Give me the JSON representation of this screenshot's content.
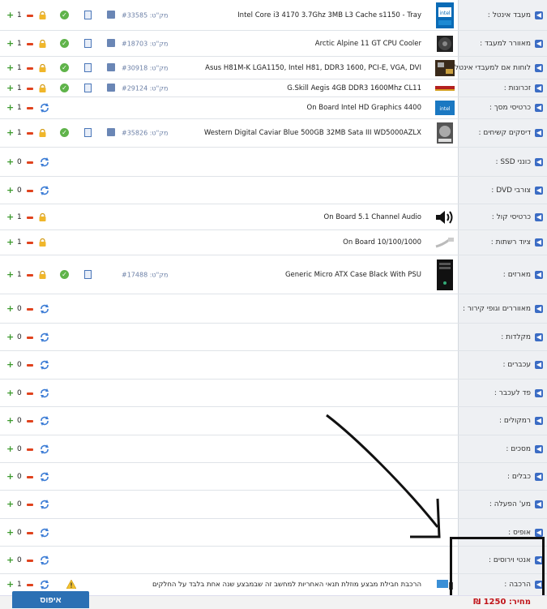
{
  "sku_prefix": "מק\"ט:",
  "rows": [
    {
      "category": "מעבד אינטל :",
      "product": "Intel Core i3 4170 3.7Ghz 3MB L3 Cache s1150 - Tray",
      "sku": "#33585",
      "qty": "1",
      "icon": "cpu-icon",
      "type": "full"
    },
    {
      "category": "מאוורר למעבד :",
      "product": "Arctic Alpine 11 GT CPU Cooler",
      "sku": "#18703",
      "qty": "1",
      "icon": "fan-icon",
      "type": "full"
    },
    {
      "category": "לוחות אם למעבדי אינטל :",
      "product": "Asus H81M-K LGA1150, Intel H81, DDR3 1600, PCI-E, VGA, DVI",
      "sku": "#30918",
      "qty": "1",
      "icon": "motherboard-icon",
      "type": "full"
    },
    {
      "category": "זכרונות :",
      "product": "G.Skill Aegis 4GB DDR3 1600Mhz CL11",
      "sku": "#29124",
      "qty": "1",
      "icon": "ram-icon",
      "type": "full"
    },
    {
      "category": "כרטיסי מסך :",
      "product": "On Board Intel HD Graphics 4400",
      "sku": "",
      "qty": "1",
      "icon": "graphics-icon",
      "type": "onboard"
    },
    {
      "category": "דיסקים קשיחים :",
      "product": "Western Digital Caviar Blue 500GB 32MB Sata III WD5000AZLX",
      "sku": "#35826",
      "qty": "1",
      "icon": "hdd-icon",
      "type": "full"
    },
    {
      "category": "כונני SSD :",
      "product": "",
      "sku": "",
      "qty": "0",
      "icon": "",
      "type": "empty"
    },
    {
      "category": "צורבי DVD :",
      "product": "",
      "sku": "",
      "qty": "0",
      "icon": "",
      "type": "empty"
    },
    {
      "category": "כרטיסי קול :",
      "product": "On Board 5.1 Channel Audio",
      "sku": "",
      "qty": "1",
      "icon": "speaker-icon",
      "type": "lockonly"
    },
    {
      "category": "ציוד רשתות :",
      "product": "On Board 10/100/1000",
      "sku": "",
      "qty": "1",
      "icon": "network-cable-icon",
      "type": "lockonly"
    },
    {
      "category": "מארזים :",
      "product": "Generic Micro ATX Case Black With PSU",
      "sku": "#17488",
      "qty": "1",
      "icon": "case-icon",
      "type": "case"
    },
    {
      "category": "מאווררים וגופי קירור :",
      "product": "",
      "sku": "",
      "qty": "0",
      "icon": "",
      "type": "empty"
    },
    {
      "category": "מקלדות :",
      "product": "",
      "sku": "",
      "qty": "0",
      "icon": "",
      "type": "empty"
    },
    {
      "category": "עכברים :",
      "product": "",
      "sku": "",
      "qty": "0",
      "icon": "",
      "type": "empty"
    },
    {
      "category": "פד לעכבר :",
      "product": "",
      "sku": "",
      "qty": "0",
      "icon": "",
      "type": "empty"
    },
    {
      "category": "רמקולים :",
      "product": "",
      "sku": "",
      "qty": "0",
      "icon": "",
      "type": "empty"
    },
    {
      "category": "מסכים :",
      "product": "",
      "sku": "",
      "qty": "0",
      "icon": "",
      "type": "empty"
    },
    {
      "category": "כבלים :",
      "product": "",
      "sku": "",
      "qty": "0",
      "icon": "",
      "type": "empty"
    },
    {
      "category": "מע' הפעלה :",
      "product": "",
      "sku": "",
      "qty": "0",
      "icon": "",
      "type": "empty"
    },
    {
      "category": "אופיס :",
      "product": "",
      "sku": "",
      "qty": "0",
      "icon": "",
      "type": "empty"
    },
    {
      "category": "אנטי וירוסים :",
      "product": "",
      "sku": "",
      "qty": "0",
      "icon": "",
      "type": "empty"
    },
    {
      "category": "הרכבה :",
      "product": "הרכבת חבילת מבצע מוזלת תנאי האחריות למחשב זה שבמבצע שנה אחת בלבד על החלקים",
      "sku": "",
      "qty": "1",
      "icon": "assembly-icon",
      "type": "assembly"
    }
  ],
  "reset_label": "איפוס",
  "price_label": "מחיר: 1250 ₪",
  "colors": {
    "accent": "#2b70b4",
    "price": "#c0141a",
    "plus": "#3d9a2e",
    "minus": "#e0431e"
  }
}
